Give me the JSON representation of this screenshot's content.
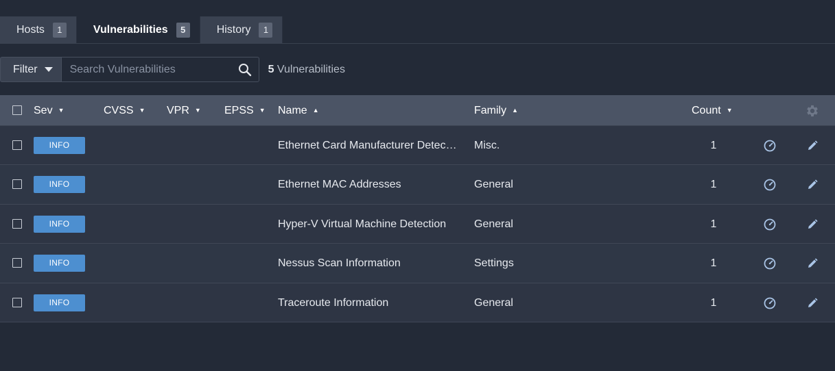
{
  "tabs": [
    {
      "label": "Hosts",
      "count": "1"
    },
    {
      "label": "Vulnerabilities",
      "count": "5"
    },
    {
      "label": "History",
      "count": "1"
    }
  ],
  "filter": {
    "label": "Filter",
    "search_placeholder": "Search Vulnerabilities",
    "result_count": "5",
    "result_label": "Vulnerabilities"
  },
  "table": {
    "headers": {
      "sev": "Sev",
      "cvss": "CVSS",
      "vpr": "VPR",
      "epss": "EPSS",
      "name": "Name",
      "family": "Family",
      "count": "Count"
    },
    "rows": [
      {
        "severity": "INFO",
        "name": "Ethernet Card Manufacturer Detection",
        "family": "Misc.",
        "count": "1"
      },
      {
        "severity": "INFO",
        "name": "Ethernet MAC Addresses",
        "family": "General",
        "count": "1"
      },
      {
        "severity": "INFO",
        "name": "Hyper-V Virtual Machine Detection",
        "family": "General",
        "count": "1"
      },
      {
        "severity": "INFO",
        "name": "Nessus Scan Information",
        "family": "Settings",
        "count": "1"
      },
      {
        "severity": "INFO",
        "name": "Traceroute Information",
        "family": "General",
        "count": "1"
      }
    ]
  },
  "colors": {
    "background": "#232a37",
    "info_badge": "#4d8fd0",
    "header_bg": "#4b5465"
  },
  "icons": {
    "search": "search-icon",
    "settings": "gear-icon",
    "snooze": "clock-icon",
    "edit": "pencil-icon"
  }
}
